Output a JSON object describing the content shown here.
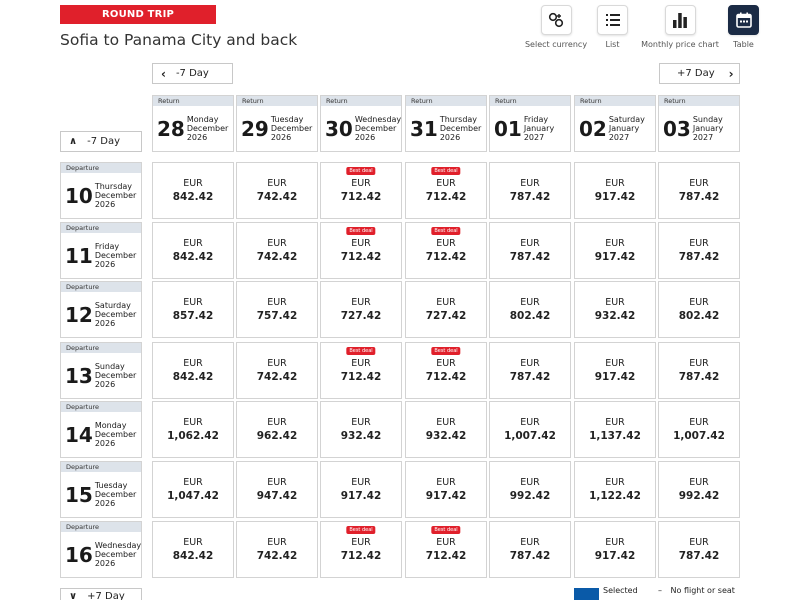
{
  "trip_type": "ROUND TRIP",
  "title": "Sofia to Panama City and back",
  "views": [
    {
      "label": "Select currency",
      "icon": "currency-icon",
      "active": false
    },
    {
      "label": "List",
      "icon": "list-icon",
      "active": false
    },
    {
      "label": "Monthly price chart",
      "icon": "bar-chart-icon",
      "active": false
    },
    {
      "label": "Table",
      "icon": "calendar-icon",
      "active": true
    }
  ],
  "nav": {
    "prev_return": "-7 Day",
    "next_return": "+7 Day",
    "prev_departure": "-7 Day",
    "next_departure": "+7 Day"
  },
  "return_label": "Return",
  "departure_label": "Departure",
  "deal_label": "Best deal",
  "currency": "EUR",
  "return_dates": [
    {
      "day": "28",
      "weekday": "Monday",
      "month": "December",
      "year": "2026"
    },
    {
      "day": "29",
      "weekday": "Tuesday",
      "month": "December",
      "year": "2026"
    },
    {
      "day": "30",
      "weekday": "Wednesday",
      "month": "December",
      "year": "2026"
    },
    {
      "day": "31",
      "weekday": "Thursday",
      "month": "December",
      "year": "2026"
    },
    {
      "day": "01",
      "weekday": "Friday",
      "month": "January",
      "year": "2027"
    },
    {
      "day": "02",
      "weekday": "Saturday",
      "month": "January",
      "year": "2027"
    },
    {
      "day": "03",
      "weekday": "Sunday",
      "month": "January",
      "year": "2027"
    }
  ],
  "departure_dates": [
    {
      "day": "10",
      "weekday": "Thursday",
      "month": "December",
      "year": "2026"
    },
    {
      "day": "11",
      "weekday": "Friday",
      "month": "December",
      "year": "2026"
    },
    {
      "day": "12",
      "weekday": "Saturday",
      "month": "December",
      "year": "2026"
    },
    {
      "day": "13",
      "weekday": "Sunday",
      "month": "December",
      "year": "2026"
    },
    {
      "day": "14",
      "weekday": "Monday",
      "month": "December",
      "year": "2026"
    },
    {
      "day": "15",
      "weekday": "Tuesday",
      "month": "December",
      "year": "2026"
    },
    {
      "day": "16",
      "weekday": "Wednesday",
      "month": "December",
      "year": "2026"
    }
  ],
  "prices": [
    [
      "842.42",
      "742.42",
      "712.42",
      "712.42",
      "787.42",
      "917.42",
      "787.42"
    ],
    [
      "842.42",
      "742.42",
      "712.42",
      "712.42",
      "787.42",
      "917.42",
      "787.42"
    ],
    [
      "857.42",
      "757.42",
      "727.42",
      "727.42",
      "802.42",
      "932.42",
      "802.42"
    ],
    [
      "842.42",
      "742.42",
      "712.42",
      "712.42",
      "787.42",
      "917.42",
      "787.42"
    ],
    [
      "1,062.42",
      "962.42",
      "932.42",
      "932.42",
      "1,007.42",
      "1,137.42",
      "1,007.42"
    ],
    [
      "1,047.42",
      "947.42",
      "917.42",
      "917.42",
      "992.42",
      "1,122.42",
      "992.42"
    ],
    [
      "842.42",
      "742.42",
      "712.42",
      "712.42",
      "787.42",
      "917.42",
      "787.42"
    ]
  ],
  "best_deals": [
    [
      false,
      false,
      true,
      true,
      false,
      false,
      false
    ],
    [
      false,
      false,
      true,
      true,
      false,
      false,
      false
    ],
    [
      false,
      false,
      false,
      false,
      false,
      false,
      false
    ],
    [
      false,
      false,
      true,
      true,
      false,
      false,
      false
    ],
    [
      false,
      false,
      false,
      false,
      false,
      false,
      false
    ],
    [
      false,
      false,
      false,
      false,
      false,
      false,
      false
    ],
    [
      false,
      false,
      true,
      true,
      false,
      false,
      false
    ]
  ],
  "legend": {
    "selected": "Selected",
    "no_flight": "No flight or seat",
    "selected_color": "#0a5aa8"
  },
  "colors": {
    "accent_red": "#e0202b",
    "active_view": "#1b2b45",
    "header_label_bg": "#dde3ea"
  }
}
